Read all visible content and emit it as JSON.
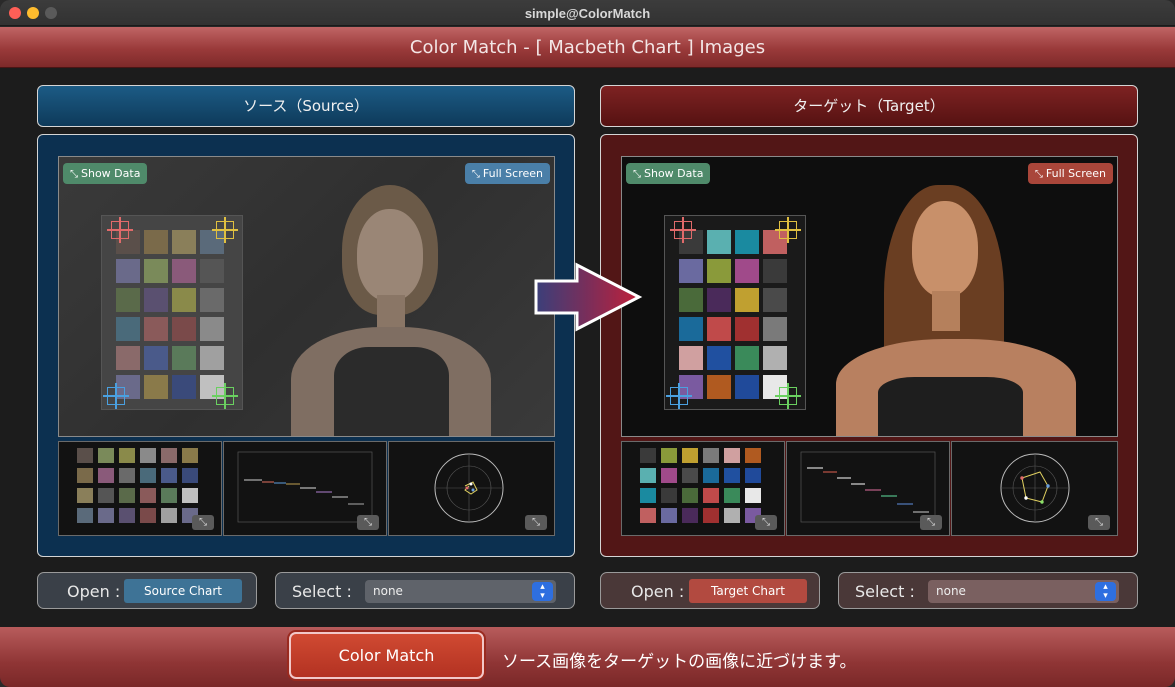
{
  "window": {
    "title": "simple@ColorMatch"
  },
  "header": {
    "title": "Color Match - [ Macbeth Chart ] Images"
  },
  "source": {
    "heading": "ソース（Source）",
    "show_data": "Show Data",
    "full_screen": "Full Screen",
    "open_label": "Open :",
    "chart_button": "Source Chart",
    "select_label": "Select :",
    "select_value": "none",
    "accent": "#1c5b85"
  },
  "target": {
    "heading": "ターゲット（Target）",
    "show_data": "Show Data",
    "full_screen": "Full Screen",
    "open_label": "Open :",
    "chart_button": "Target Chart",
    "select_label": "Select :",
    "select_value": "none",
    "accent": "#7e2222"
  },
  "footer": {
    "button": "Color Match",
    "message": "ソース画像をターゲットの画像に近づけます。"
  },
  "icons": {
    "expand": "expand-icon",
    "arrow": "right-arrow-icon",
    "stepper": "up-down-chevron-icon"
  }
}
